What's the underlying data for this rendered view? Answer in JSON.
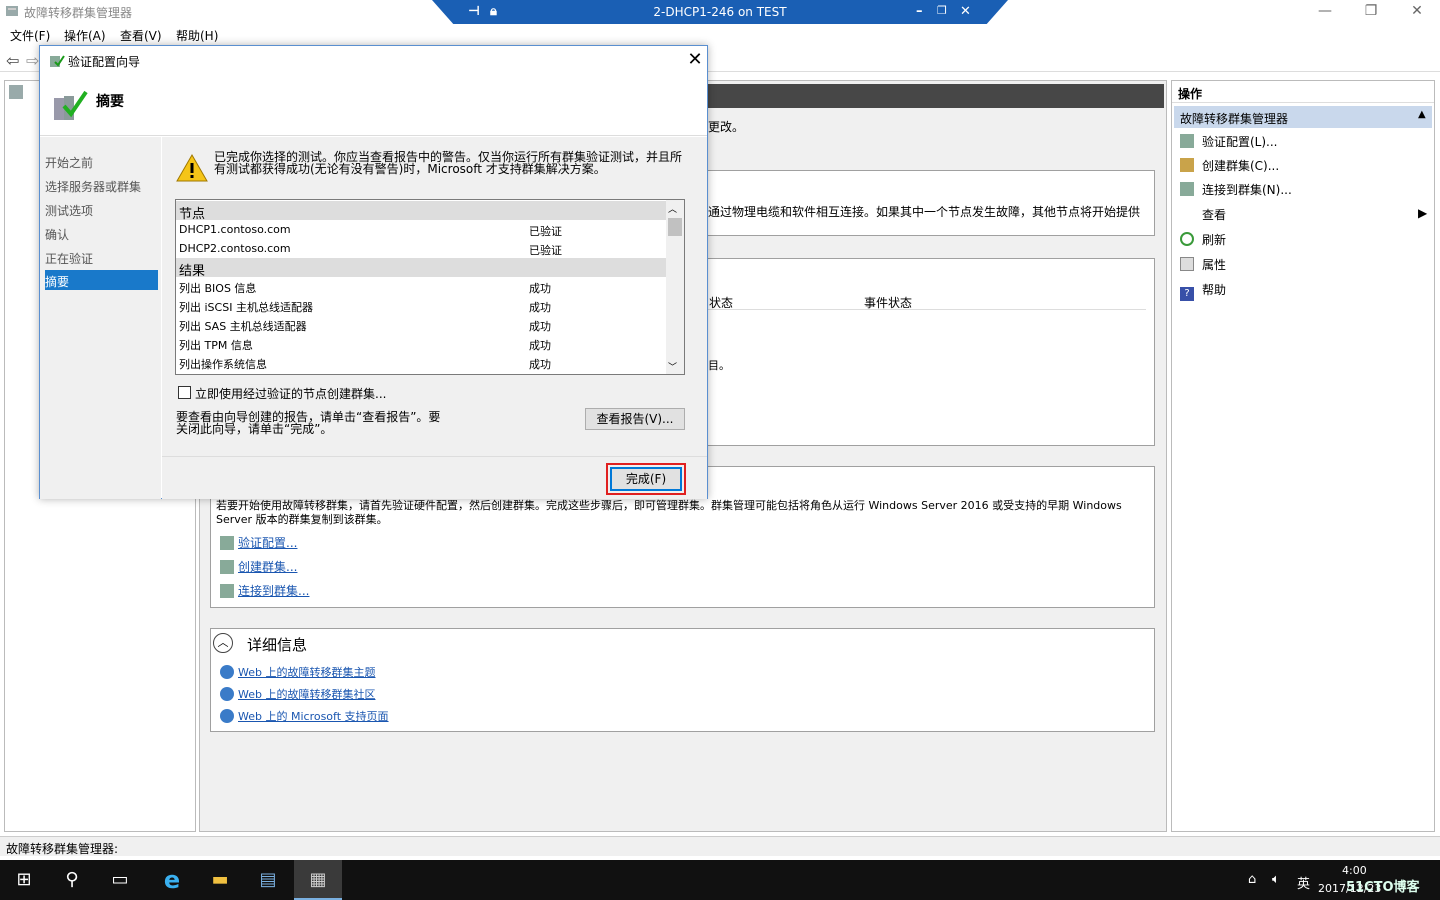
{
  "window": {
    "title": "故障转移群集管理器",
    "min": "—",
    "max": "❐",
    "close": "✕"
  },
  "rdp": {
    "title": "2-DHCP1-246 on TEST",
    "min": "–",
    "restore": "❐",
    "close": "✕"
  },
  "menu": [
    "文件(F)",
    "操作(A)",
    "查看(V)",
    "帮助(H)"
  ],
  "main": {
    "partial_text1": "更改。",
    "partial_text2": "通过物理电缆和软件相互连接。如果其中一个节点发生故障，其他节点将开始提供",
    "col_status": "状态",
    "col_event_status": "事件状态",
    "partial_text3": "目。",
    "create_text": "若要开始使用故障转移群集，请首先验证硬件配置，然后创建群集。完成这些步骤后，即可管理群集。群集管理可能包括将角色从运行 Windows Server 2016 或受支持的早期 Windows Server 版本的群集复制到该群集。",
    "links": [
      "验证配置...",
      "创建群集...",
      "连接到群集..."
    ],
    "details_title": "详细信息",
    "web_links": [
      "Web 上的故障转移群集主题",
      "Web 上的故障转移群集社区",
      "Web 上的 Microsoft 支持页面"
    ]
  },
  "actions": {
    "header": "操作",
    "section": "故障转移群集管理器",
    "items": [
      "验证配置(L)...",
      "创建群集(C)...",
      "连接到群集(N)...",
      "查看",
      "刷新",
      "属性",
      "帮助"
    ]
  },
  "status_bar": "故障转移群集管理器:",
  "dialog": {
    "title": "验证配置向导",
    "heading": "摘要",
    "nav": [
      "开始之前",
      "选择服务器或群集",
      "测试选项",
      "确认",
      "正在验证",
      "摘要"
    ],
    "warning": "已完成你选择的测试。你应当查看报告中的警告。仅当你运行所有群集验证测试，并且所有测试都获得成功(无论有没有警告)时，Microsoft 才支持群集解决方案。",
    "nodes_header": "节点",
    "nodes": [
      {
        "name": "DHCP1.contoso.com",
        "status": "已验证"
      },
      {
        "name": "DHCP2.contoso.com",
        "status": "已验证"
      }
    ],
    "results_header": "结果",
    "results": [
      {
        "name": "列出 BIOS 信息",
        "status": "成功"
      },
      {
        "name": "列出 iSCSI 主机总线适配器",
        "status": "成功"
      },
      {
        "name": "列出 SAS 主机总线适配器",
        "status": "成功"
      },
      {
        "name": "列出 TPM 信息",
        "status": "成功"
      },
      {
        "name": "列出操作系统信息",
        "status": "成功"
      }
    ],
    "checkbox_label": "立即使用经过验证的节点创建群集...",
    "report_text": "要查看由向导创建的报告，请单击“查看报告”。要关闭此向导，请单击“完成”。",
    "view_report": "查看报告(V)...",
    "finish": "完成(F)"
  },
  "taskbar": {
    "lang": "英",
    "time": "4:00",
    "date": "2017/12/23",
    "watermark": "51CTO博客"
  }
}
